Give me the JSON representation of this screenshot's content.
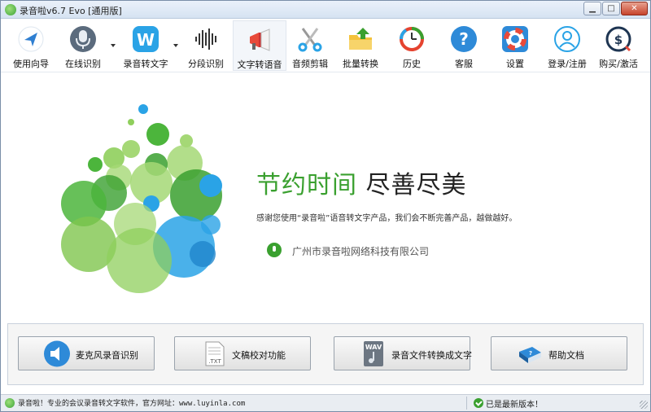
{
  "window": {
    "title": "录音啦v6.7 Evo [通用版]"
  },
  "toolbar": {
    "items": [
      {
        "label": "使用向导",
        "icon": "navigation-arrow-icon"
      },
      {
        "label": "在线识别",
        "icon": "microphone-icon"
      },
      {
        "label": "录音转文字",
        "icon": "letter-w-icon"
      },
      {
        "label": "分段识别",
        "icon": "waveform-icon"
      },
      {
        "label": "文字转语音",
        "icon": "megaphone-icon"
      },
      {
        "label": "音频剪辑",
        "icon": "scissors-icon"
      },
      {
        "label": "批量转换",
        "icon": "folder-arrow-icon"
      },
      {
        "label": "历史",
        "icon": "history-clock-icon"
      },
      {
        "label": "客服",
        "icon": "help-question-icon"
      },
      {
        "label": "设置",
        "icon": "lifebuoy-icon"
      },
      {
        "label": "登录/注册",
        "icon": "user-icon"
      },
      {
        "label": "购买/激活",
        "icon": "purchase-coin-icon"
      }
    ]
  },
  "main": {
    "headline_green": "节约时间",
    "headline_black": "尽善尽美",
    "subline": "感谢您使用“录音啦”语音转文字产品，我们会不断完善产品，越做越好。",
    "company": "广州市录音啦网络科技有限公司"
  },
  "buttons": [
    {
      "label": "麦克风录音识别",
      "icon": "speaker-icon"
    },
    {
      "label": "文稿校对功能",
      "icon": "txt-document-icon"
    },
    {
      "label": "录音文件转换成文字",
      "icon": "wav-file-icon"
    },
    {
      "label": "帮助文档",
      "icon": "help-book-icon"
    }
  ],
  "status": {
    "left": "录音啦！专业的会议录音转文字软件，官方网址：www.luyinla.com",
    "right": "已是最新版本！"
  },
  "colors": {
    "accent_green": "#3aa02f",
    "accent_blue": "#2e9bdc",
    "titlebar": "#dbe6f3"
  }
}
